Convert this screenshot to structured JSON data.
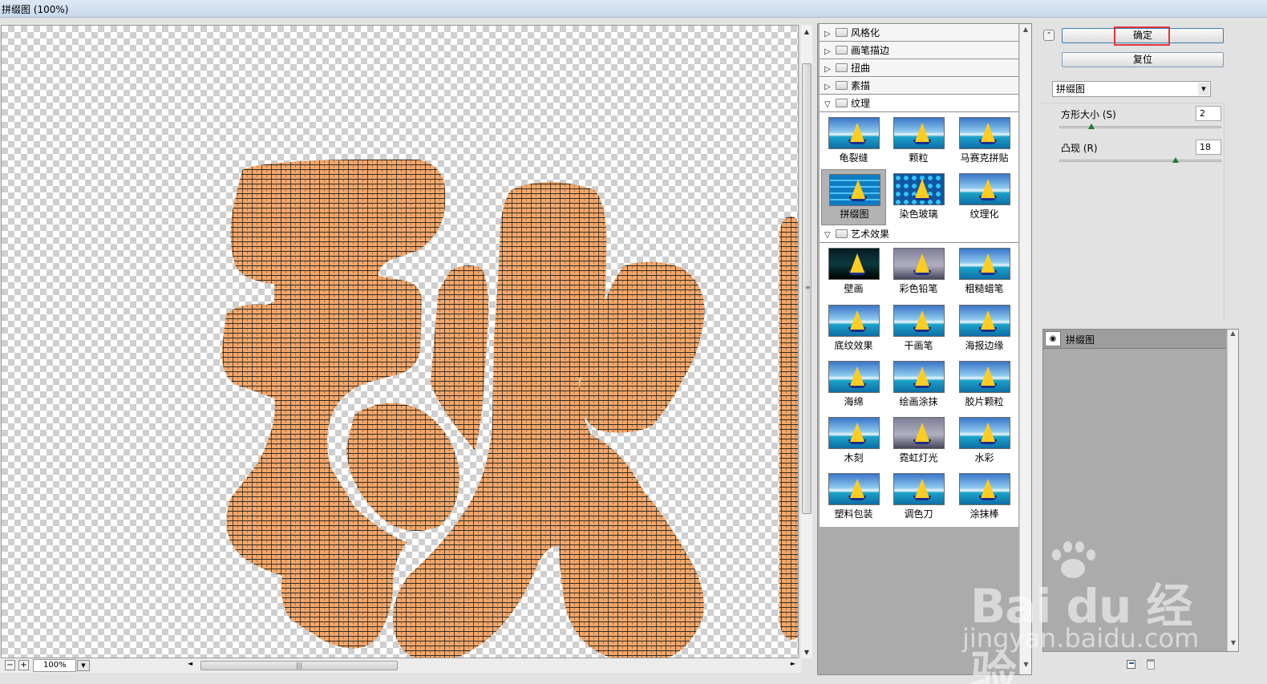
{
  "window": {
    "title": "拼缀图 (100%)"
  },
  "statusbar": {
    "zoom_minus": "−",
    "zoom_plus": "+",
    "zoom": "100%"
  },
  "gallery": {
    "categories": [
      {
        "label": "风格化",
        "open": false
      },
      {
        "label": "画笔描边",
        "open": false
      },
      {
        "label": "扭曲",
        "open": false
      },
      {
        "label": "素描",
        "open": false
      },
      {
        "label": "纹理",
        "open": true
      },
      {
        "label": "艺术效果",
        "open": true
      }
    ],
    "texture_filters": [
      "龟裂缝",
      "颗粒",
      "马赛克拼贴",
      "拼缀图",
      "染色玻璃",
      "纹理化"
    ],
    "artistic_filters": [
      "壁画",
      "彩色铅笔",
      "粗糙蜡笔",
      "底纹效果",
      "干画笔",
      "海报边缘",
      "海绵",
      "绘画涂抹",
      "胶片颗粒",
      "木刻",
      "霓虹灯光",
      "水彩",
      "塑料包装",
      "调色刀",
      "涂抹棒"
    ],
    "selected": "拼缀图"
  },
  "controls": {
    "ok_label": "确定",
    "reset_label": "复位",
    "filter_select": "拼缀图",
    "params": [
      {
        "label": "方形大小 (S)",
        "value": "2",
        "fraction": 0.2
      },
      {
        "label": "凸现 (R)",
        "value": "18",
        "fraction": 0.72
      }
    ]
  },
  "layers": {
    "name": "拼缀图"
  },
  "watermark": {
    "brand": "Bai du 经验",
    "url": "jingyan.baidu.com"
  },
  "colors": {
    "tile_fill": "#f4a76a",
    "tile_grout": "#2c2a22",
    "ok_highlight": "#e0363c"
  },
  "icons": [
    "expand-arrow-icon",
    "folder-icon",
    "eye-icon",
    "new-layer-icon",
    "trash-icon",
    "collapse-icon",
    "paw-icon"
  ]
}
